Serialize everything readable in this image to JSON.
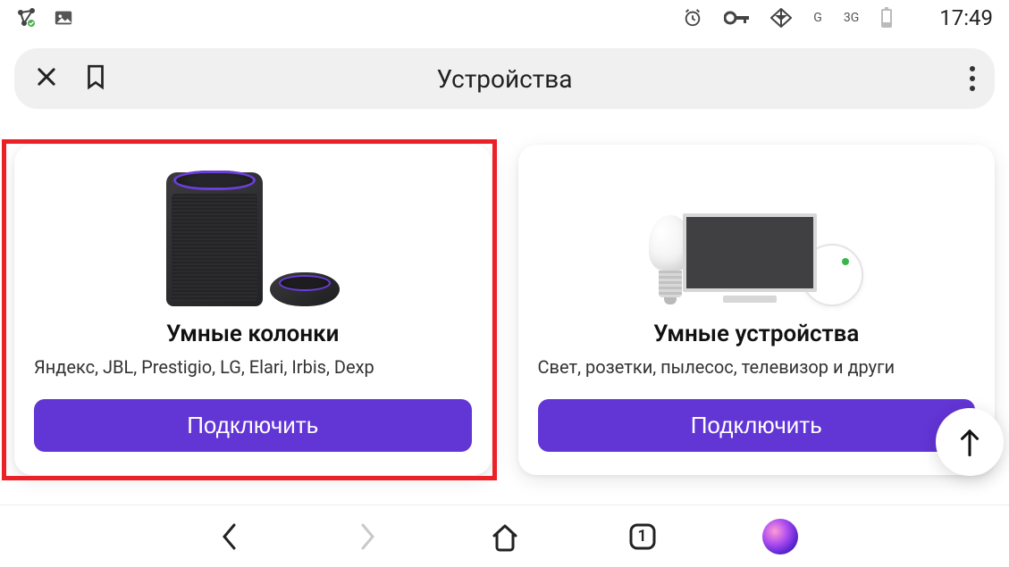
{
  "statusbar": {
    "signal_g": "G",
    "signal_3g": "3G",
    "time": "17:49"
  },
  "header": {
    "title": "Устройства"
  },
  "cards": [
    {
      "title": "Умные колонки",
      "subtitle": "Яндекс, JBL, Prestigio, LG, Elari, Irbis, Dexp",
      "button": "Подключить",
      "highlighted": true
    },
    {
      "title": "Умные устройства",
      "subtitle": "Свет, розетки, пылесос, телевизор и други",
      "button": "Подключить",
      "highlighted": false
    }
  ],
  "bottomnav": {
    "tab_count": "1"
  },
  "colors": {
    "accent": "#6235d5",
    "highlight_border": "#ec2127"
  }
}
